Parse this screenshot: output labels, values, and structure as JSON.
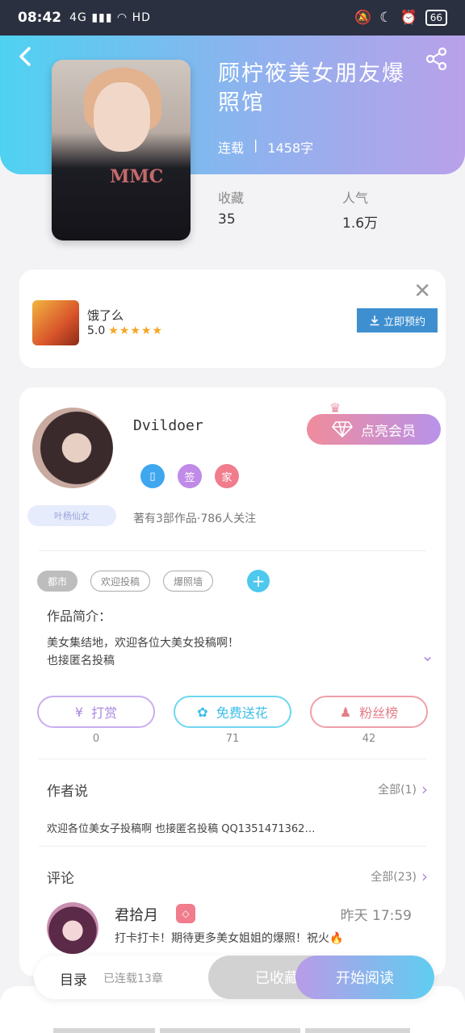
{
  "status_bar": {
    "time": "08:42",
    "network": "4G",
    "hd": "HD",
    "battery": "66"
  },
  "book": {
    "title": "顾柠筱美女朋友爆照馆",
    "status": "连载",
    "words": "1458字",
    "stats": [
      {
        "label": "收藏",
        "value": "35"
      },
      {
        "label": "人气",
        "value": "1.6万"
      }
    ],
    "cover_text": "MMC"
  },
  "ad": {
    "name": "饿了么",
    "rating": "5.0",
    "stars": "★★★★★",
    "button": "立即预约"
  },
  "author": {
    "name": "Dvildoer",
    "vip_button": "点亮会员",
    "badges": [
      "",
      "签",
      "家"
    ],
    "title_tag": "叶杨仙女",
    "stats": "著有3部作品·786人关注"
  },
  "tags": [
    "都市",
    "欢迎投稿",
    "爆照墙"
  ],
  "intro": {
    "label": "作品简介：",
    "line1": "美女集结地，欢迎各位大美女投稿啊！",
    "line2": "也接匿名投稿"
  },
  "actions": [
    {
      "label": "打赏",
      "count": "0",
      "icon": "¥"
    },
    {
      "label": "免费送花",
      "count": "71",
      "icon": "✿"
    },
    {
      "label": "粉丝榜",
      "count": "42",
      "icon": "♟"
    }
  ],
  "author_says": {
    "title": "作者说",
    "more": "全部(1)",
    "text": "欢迎各位美女子投稿啊 也接匿名投稿 QQ1351471362…"
  },
  "comments": {
    "title": "评论",
    "more": "全部(23)",
    "first": {
      "name": "君拾月",
      "time": "昨天 17:59",
      "text": "打卡打卡！期待更多美女姐姐的爆照！祝火🔥"
    }
  },
  "bottom": {
    "toc": "目录",
    "status": "已连载13章",
    "collected": "已收藏",
    "read": "开始阅读"
  },
  "colors": {
    "accent_blue": "#4fd2f2",
    "accent_purple": "#b9a1ea",
    "vip_pink": "#f08c9c",
    "ad_blue": "#3d8fd0"
  }
}
